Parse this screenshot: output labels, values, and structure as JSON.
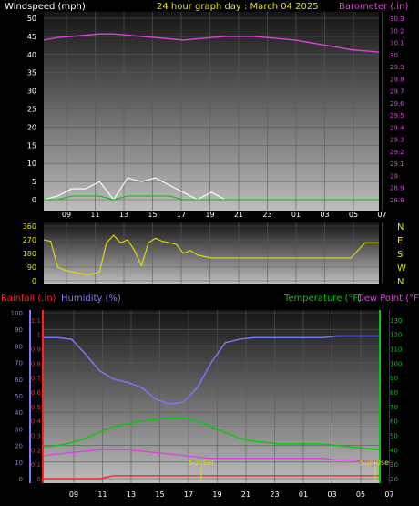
{
  "chart_data": [
    {
      "type": "line",
      "panel": "wind-barometer",
      "title": "24 hour graph day : March 04 2025",
      "ylabel_left": "Windspeed (mph)",
      "ylabel_right": "Barometer (.in)",
      "ylim_left": [
        0,
        50
      ],
      "yticks_left": [
        "0",
        "5",
        "10",
        "15",
        "20",
        "25",
        "30",
        "35",
        "40",
        "45",
        "50"
      ],
      "ylim_right": [
        28.8,
        30.3
      ],
      "yticks_right": [
        "28.8",
        "28.9",
        "29",
        "29.1",
        "29.2",
        "29.3",
        "29.4",
        "29.5",
        "29.6",
        "29.7",
        "29.8",
        "29.9",
        "30",
        "30.1",
        "30.2",
        "30.3"
      ],
      "x_ticks": [
        "09",
        "11",
        "13",
        "15",
        "17",
        "19",
        "21",
        "23",
        "01",
        "03",
        "05",
        "07"
      ],
      "grid": true,
      "series": [
        {
          "name": "Barometer (.in)",
          "color": "#e040e0",
          "axis": "right",
          "x": [
            0,
            1,
            2,
            3,
            4,
            5,
            6,
            7,
            8,
            9,
            10,
            11,
            12,
            13,
            14,
            15,
            16,
            17,
            18,
            19,
            20,
            21,
            22,
            23,
            24
          ],
          "values": [
            30.12,
            30.14,
            30.15,
            30.16,
            30.17,
            30.17,
            30.16,
            30.15,
            30.14,
            30.13,
            30.12,
            30.13,
            30.14,
            30.15,
            30.15,
            30.15,
            30.14,
            30.13,
            30.12,
            30.1,
            30.08,
            30.06,
            30.04,
            30.03,
            30.02
          ]
        },
        {
          "name": "Wind gust (mph)",
          "color": "#ffffff",
          "axis": "left",
          "x": [
            0,
            1,
            2,
            3,
            4,
            5,
            6,
            7,
            8,
            9,
            10,
            11,
            12,
            13,
            14,
            15,
            16,
            17,
            18,
            19,
            20,
            21,
            22,
            23,
            24
          ],
          "values": [
            0,
            1,
            3,
            3,
            5,
            0,
            6,
            5,
            6,
            4,
            2,
            0,
            2,
            0,
            0,
            0,
            0,
            0,
            0,
            0,
            0,
            0,
            0,
            0,
            0
          ]
        },
        {
          "name": "Wind average (mph)",
          "color": "#00c000",
          "axis": "left",
          "x": [
            0,
            1,
            2,
            3,
            4,
            5,
            6,
            7,
            8,
            9,
            10,
            11,
            12,
            13,
            14,
            15,
            16,
            17,
            18,
            19,
            20,
            21,
            22,
            23,
            24
          ],
          "values": [
            0,
            0,
            1,
            1,
            1,
            0,
            1,
            1,
            1,
            1,
            0,
            0,
            0,
            0,
            0,
            0,
            0,
            0,
            0,
            0,
            0,
            0,
            0,
            0,
            0
          ]
        }
      ]
    },
    {
      "type": "line",
      "panel": "wind-direction",
      "ylim": [
        0,
        360
      ],
      "yticks_left": [
        "0",
        "90",
        "180",
        "270",
        "360"
      ],
      "compass_labels": [
        "N",
        "W",
        "S",
        "E",
        "N"
      ],
      "x_ticks": [
        "09",
        "11",
        "13",
        "15",
        "17",
        "19",
        "21",
        "23",
        "01",
        "03",
        "05",
        "07"
      ],
      "grid": true,
      "series": [
        {
          "name": "Wind direction",
          "color": "#e6e600",
          "x": [
            0,
            0.5,
            1,
            1.5,
            2,
            2.5,
            3,
            3.5,
            4,
            4.5,
            5,
            5.5,
            6,
            6.5,
            7,
            7.5,
            8,
            8.5,
            9,
            9.5,
            10,
            10.5,
            11,
            12,
            13,
            14,
            15,
            16,
            17,
            18,
            19,
            20,
            21,
            22,
            23,
            24
          ],
          "values": [
            270,
            260,
            90,
            70,
            60,
            50,
            40,
            45,
            60,
            250,
            300,
            250,
            270,
            200,
            100,
            250,
            280,
            260,
            250,
            240,
            180,
            200,
            170,
            150,
            150,
            150,
            150,
            150,
            150,
            150,
            150,
            150,
            150,
            150,
            250,
            250
          ]
        }
      ]
    },
    {
      "type": "line",
      "panel": "rain-humidity-temperature",
      "ylabel_left": "Rainfall (.in)",
      "label_humidity": "Humidity (%)",
      "ylabel_right": "Temperature (°F)",
      "label_dewpoint": "Dew Point (°F)",
      "yticks_rain": [
        "0",
        "0.1",
        "0.2",
        "0.3",
        "0.4",
        "0.5",
        "0.6",
        "0.7",
        "0.8",
        "0.9",
        "1",
        "1.1"
      ],
      "yticks_humidity": [
        "0",
        "10",
        "20",
        "30",
        "40",
        "50",
        "60",
        "70",
        "80",
        "90",
        "100"
      ],
      "yticks_temp": [
        "20",
        "30",
        "40",
        "50",
        "60",
        "70",
        "80",
        "90",
        "100",
        "110",
        "120",
        "130"
      ],
      "ylim_humidity": [
        0,
        100
      ],
      "ylim_temp": [
        20,
        135
      ],
      "x_ticks": [
        "09",
        "11",
        "13",
        "15",
        "17",
        "19",
        "21",
        "23",
        "01",
        "03",
        "05",
        "07"
      ],
      "annotations": [
        "SunSet",
        "SunRise"
      ],
      "grid": true,
      "series": [
        {
          "name": "Humidity (%)",
          "color": "#7b7bff",
          "axis": "humidity",
          "x": [
            0,
            1,
            2,
            3,
            4,
            5,
            6,
            7,
            8,
            9,
            10,
            11,
            12,
            13,
            14,
            15,
            16,
            17,
            18,
            19,
            20,
            21,
            22,
            23,
            24
          ],
          "values": [
            85,
            85,
            84,
            75,
            65,
            60,
            58,
            55,
            48,
            45,
            46,
            55,
            70,
            82,
            84,
            85,
            85,
            85,
            85,
            85,
            85,
            86,
            86,
            86,
            86
          ]
        },
        {
          "name": "Temperature (°F)",
          "color": "#00cc00",
          "axis": "temp",
          "x": [
            0,
            1,
            2,
            3,
            4,
            5,
            6,
            7,
            8,
            9,
            10,
            11,
            12,
            13,
            14,
            15,
            16,
            17,
            18,
            19,
            20,
            21,
            22,
            23,
            24
          ],
          "values": [
            42,
            43,
            45,
            48,
            52,
            56,
            58,
            60,
            61,
            62,
            62,
            60,
            56,
            52,
            48,
            46,
            45,
            44,
            44,
            44,
            44,
            43,
            42,
            41,
            40
          ]
        },
        {
          "name": "Dew Point (°F)",
          "color": "#e040e0",
          "axis": "temp",
          "x": [
            0,
            1,
            2,
            3,
            4,
            5,
            6,
            7,
            8,
            9,
            10,
            11,
            12,
            13,
            14,
            15,
            16,
            17,
            18,
            19,
            20,
            21,
            22,
            23,
            24
          ],
          "values": [
            36,
            37,
            38,
            39,
            40,
            40,
            40,
            39,
            38,
            37,
            36,
            35,
            34,
            34,
            34,
            34,
            34,
            34,
            34,
            34,
            34,
            33,
            33,
            32,
            32
          ]
        },
        {
          "name": "Rainfall (.in)",
          "color": "#ff2020",
          "axis": "rain",
          "x": [
            0,
            1,
            2,
            3,
            4,
            5,
            6,
            7,
            8,
            9,
            10,
            11,
            12,
            13,
            14,
            15,
            16,
            17,
            18,
            19,
            20,
            21,
            22,
            23,
            24
          ],
          "values": [
            0,
            0,
            0,
            0,
            0,
            0.02,
            0.02,
            0.02,
            0.02,
            0.02,
            0.02,
            0.02,
            0.02,
            0.02,
            0.02,
            0.02,
            0.02,
            0.02,
            0.02,
            0.02,
            0.02,
            0.02,
            0.02,
            0.02,
            0.02
          ]
        }
      ]
    }
  ]
}
